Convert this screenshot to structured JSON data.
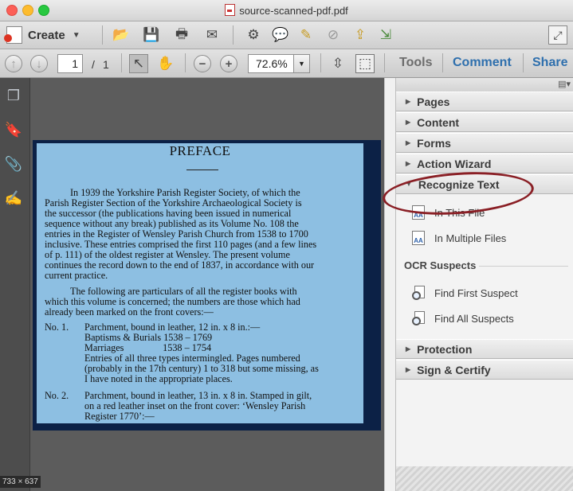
{
  "window": {
    "title": "source-scanned-pdf.pdf",
    "size_tag": "733 × 637"
  },
  "toolbar": {
    "create_label": "Create",
    "icons": [
      "open-folder-icon",
      "save-icon",
      "print-icon",
      "email-icon",
      "gear-icon",
      "comment-icon",
      "highlight-icon",
      "sign-icon",
      "send-icon",
      "share-icon"
    ]
  },
  "nav": {
    "page_current": "1",
    "page_separator": "/",
    "page_total": "1",
    "zoom": "72.6%",
    "tabs": {
      "tools": "Tools",
      "comment": "Comment",
      "share": "Share"
    }
  },
  "colors": {
    "accent": "#2e6fad",
    "annotation": "#8a1f25"
  },
  "document": {
    "heading": "PREFACE",
    "lines": [
      "In 1939 the Yorkshire Parish Register Society, of which the",
      "Parish Register Section of the Yorkshire Archaeological Society is",
      "the successor (the publications having been issued in numerical",
      "sequence without any break) published as its Volume No. 108 the",
      "entries in the Register of Wensley Parish Church from 1538 to 1700",
      "inclusive.  These entries comprised the first 110 pages (and a few lines",
      "of p. 111) of the oldest register at Wensley.  The present volume",
      "continues the record down to the end of 1837, in accordance with our",
      "current practice.",
      "The following are particulars of all the register books with",
      "which this volume is concerned; the numbers are those which had",
      "already been marked on the front covers:—"
    ],
    "entries": [
      {
        "no": "No. 1.",
        "lines": [
          "Parchment, bound in leather, 12 in. x 8 in.:—",
          "Baptisms & Burials 1538 – 1769",
          "Marriages                1538 – 1754",
          "Entries of all three types intermingled.  Pages numbered",
          "(probably in the 17th century) 1 to 318 but some missing, as",
          "I have noted in the appropriate places."
        ]
      },
      {
        "no": "No. 2.",
        "lines": [
          "Parchment, bound in leather, 13 in. x 8 in.  Stamped in gilt,",
          "on a red leather inset on the front cover: ‘Wensley Parish",
          "Register 1770’:—"
        ]
      }
    ]
  },
  "panel": {
    "sections_top": [
      "Pages",
      "Content",
      "Forms",
      "Action Wizard"
    ],
    "recognize_text": {
      "label": "Recognize Text",
      "items": [
        "In This File",
        "In Multiple Files"
      ],
      "ocr_heading": "OCR Suspects",
      "ocr_items": [
        "Find First Suspect",
        "Find All Suspects"
      ]
    },
    "sections_bottom": [
      "Protection",
      "Sign & Certify"
    ]
  }
}
